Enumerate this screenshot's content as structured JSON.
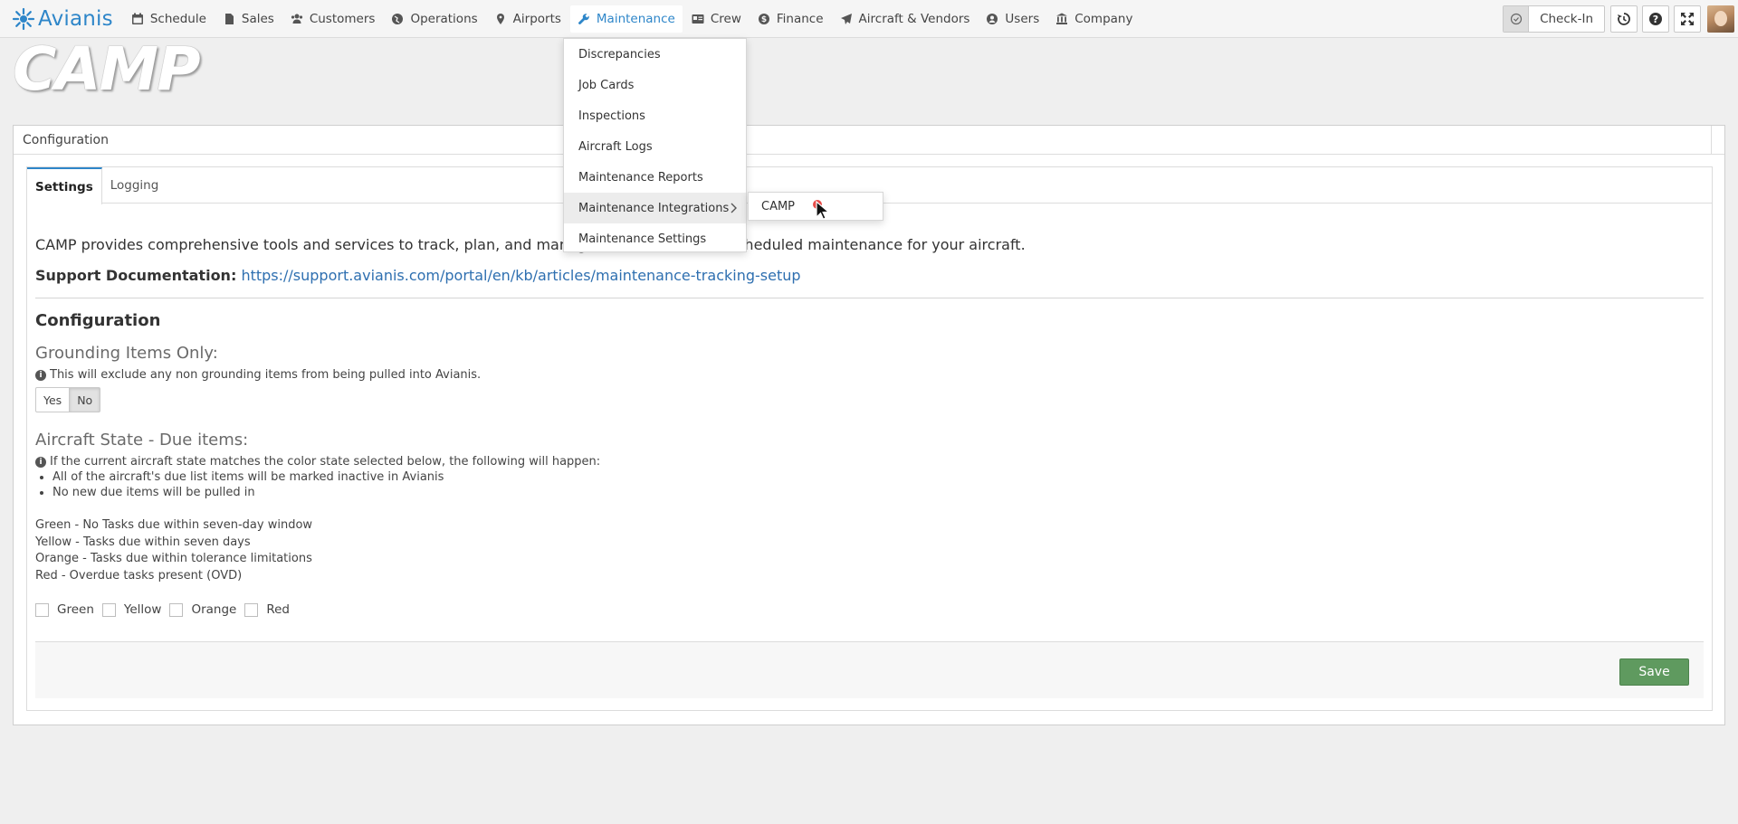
{
  "brand": {
    "name": "Avianis",
    "accent": "#2e86c9"
  },
  "nav": {
    "items": [
      {
        "label": "Schedule",
        "icon": "calendar-icon"
      },
      {
        "label": "Sales",
        "icon": "file-icon"
      },
      {
        "label": "Customers",
        "icon": "users-icon"
      },
      {
        "label": "Operations",
        "icon": "globe-icon"
      },
      {
        "label": "Airports",
        "icon": "map-marker-icon"
      },
      {
        "label": "Maintenance",
        "icon": "wrench-icon",
        "active": true
      },
      {
        "label": "Crew",
        "icon": "id-card-icon"
      },
      {
        "label": "Finance",
        "icon": "dollar-circle-icon"
      },
      {
        "label": "Aircraft & Vendors",
        "icon": "plane-icon"
      },
      {
        "label": "Users",
        "icon": "user-circle-icon"
      },
      {
        "label": "Company",
        "icon": "bank-icon"
      }
    ],
    "checkin_label": "Check-In"
  },
  "logo_text": "CAMP",
  "panel": {
    "title": "Configuration"
  },
  "tabs": {
    "settings": "Settings",
    "logging": "Logging"
  },
  "content": {
    "intro": "CAMP provides comprehensive tools and services to track, plan, and manage scheduled and unscheduled maintenance for your aircraft.",
    "support_label": "Support Documentation:",
    "support_link": "https://support.avianis.com/portal/en/kb/articles/maintenance-tracking-setup",
    "section_title": "Configuration",
    "grounding": {
      "label": "Grounding Items Only:",
      "help": "This will exclude any non grounding items from being pulled into Avianis.",
      "yes": "Yes",
      "no": "No",
      "selected": "No"
    },
    "aircraft_state": {
      "label": "Aircraft State - Due items:",
      "help": "If the current aircraft state matches the color state selected below, the following will happen:",
      "bullets": [
        "All of the aircraft's due list items will be marked inactive in Avianis",
        "No new due items will be pulled in"
      ],
      "states": [
        "Green - No Tasks due within seven-day window",
        "Yellow - Tasks due within seven days",
        "Orange - Tasks due within tolerance limitations",
        "Red - Overdue tasks present (OVD)"
      ],
      "checkboxes": [
        "Green",
        "Yellow",
        "Orange",
        "Red"
      ]
    },
    "save_label": "Save"
  },
  "dropdown": {
    "items": [
      "Discrepancies",
      "Job Cards",
      "Inspections",
      "Aircraft Logs",
      "Maintenance Reports",
      "Maintenance Integrations",
      "Maintenance Settings"
    ],
    "submenu": [
      "CAMP"
    ]
  }
}
